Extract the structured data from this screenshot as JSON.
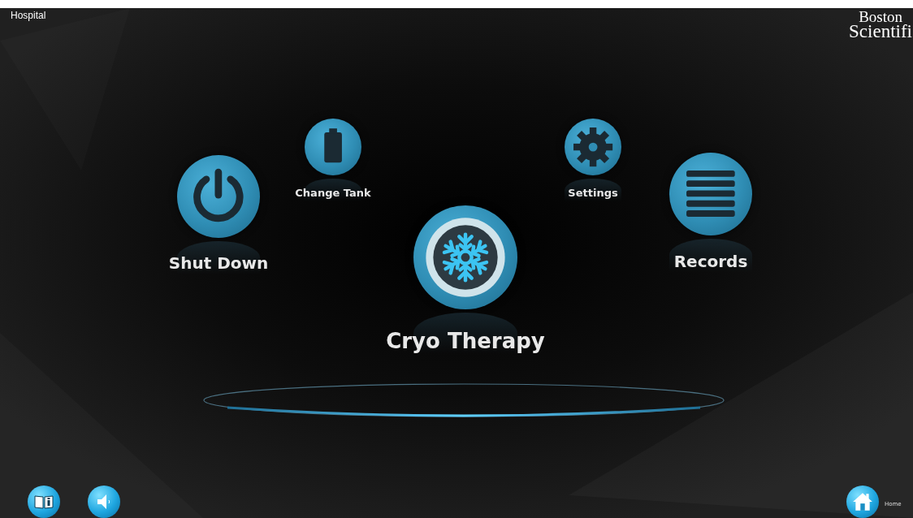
{
  "header": {
    "site": "Hospital",
    "logo": [
      "Boston",
      "Scientifi"
    ]
  },
  "menu": [
    {
      "kind": "power",
      "label": "Shut Down"
    },
    {
      "kind": "tank",
      "label": "Change Tank"
    },
    {
      "kind": "snowflake",
      "label": "Cryo Therapy"
    },
    {
      "kind": "gear",
      "label": "Settings"
    },
    {
      "kind": "list",
      "label": "Records"
    }
  ],
  "footer": {
    "left": [
      {
        "kind": "manual"
      },
      {
        "kind": "sound"
      }
    ],
    "home": {
      "label": "Home"
    }
  }
}
